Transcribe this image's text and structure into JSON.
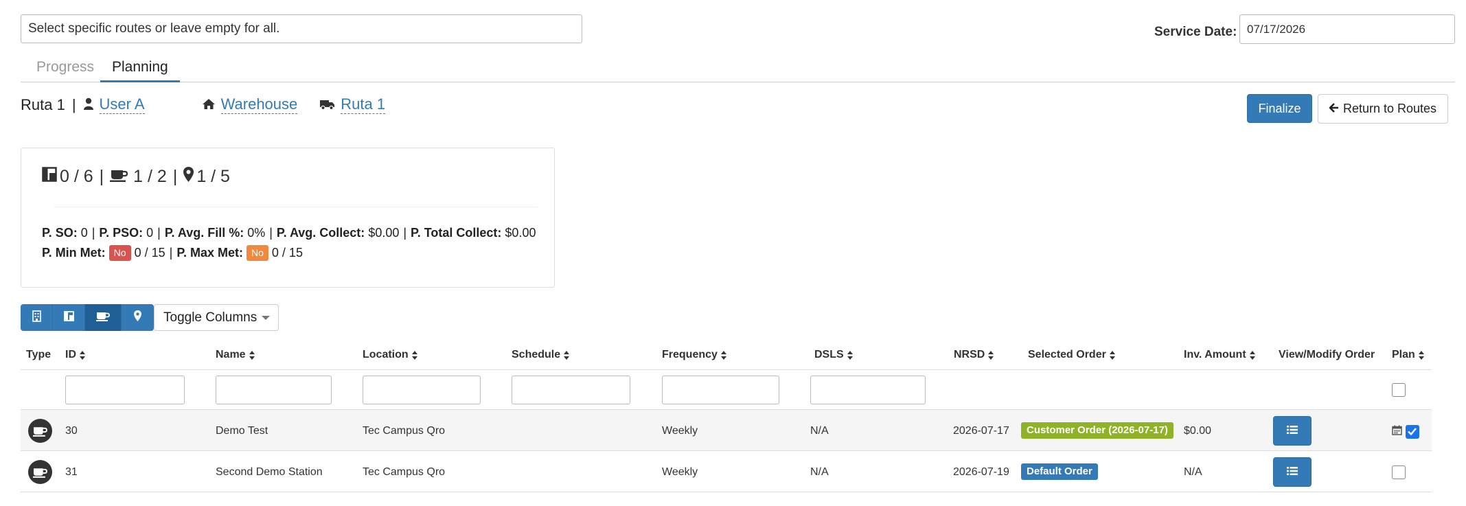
{
  "routes_filter": {
    "placeholder": "Select specific routes or leave empty for all."
  },
  "service_date": {
    "label": "Service Date:",
    "value": "07/17/2026"
  },
  "tabs": [
    {
      "label": "Progress",
      "active": false
    },
    {
      "label": "Planning",
      "active": true
    }
  ],
  "route": {
    "name": "Ruta 1",
    "sep": "|",
    "user_icon": "user-icon",
    "user": "User A",
    "warehouse_icon": "home-icon",
    "warehouse": "Warehouse",
    "vehicle_icon": "truck-icon",
    "vehicle": "Ruta 1"
  },
  "actions": {
    "finalize": "Finalize",
    "return": "Return to Routes",
    "return_icon": "arrow-left-icon"
  },
  "stats": {
    "counts": [
      {
        "icon": "columns-icon",
        "value": "0 / 6"
      },
      {
        "icon": "coffee-icon",
        "value": "1 / 2"
      },
      {
        "icon": "map-marker-icon",
        "value": "1 / 5"
      }
    ],
    "sep": "|",
    "so_label": "P. SO:",
    "so_value": "0",
    "pso_label": "P. PSO:",
    "pso_value": "0",
    "fill_label": "P. Avg. Fill %:",
    "fill_value": "0%",
    "collect_label": "P. Avg. Collect:",
    "collect_value": "$0.00",
    "total_label": "P. Total Collect:",
    "total_value": "$0.00",
    "min_label": "P. Min Met:",
    "min_badge": "No",
    "min_value": "0 / 15",
    "max_label": "P. Max Met:",
    "max_badge": "No",
    "max_value": "0 / 15"
  },
  "colors": {
    "primary": "#337ab7",
    "primary_dark": "#1f5f96",
    "badge_min": "#d9534f",
    "badge_max": "#f0883e",
    "order_customer": "#8fb227",
    "order_default": "#337ab7"
  },
  "view_buttons": [
    {
      "icon": "building-icon",
      "active": false
    },
    {
      "icon": "columns-icon",
      "active": false
    },
    {
      "icon": "coffee-icon",
      "active": true
    },
    {
      "icon": "map-marker-icon",
      "active": false
    }
  ],
  "toggle_columns": "Toggle Columns",
  "table": {
    "headers": {
      "type": "Type",
      "id": "ID",
      "name": "Name",
      "location": "Location",
      "schedule": "Schedule",
      "frequency": "Frequency",
      "dsls": "DSLS",
      "nrsd": "NRSD",
      "selected_order": "Selected Order",
      "inv_amount": "Inv. Amount",
      "view_modify": "View/Modify Order",
      "plan": "Plan"
    },
    "rows": [
      {
        "type_icon": "coffee-icon",
        "id": "30",
        "name": "Demo Test",
        "location": "Tec Campus Qro",
        "schedule": "",
        "frequency": "Weekly",
        "dsls": "N/A",
        "nrsd": "2026-07-17",
        "order": "Customer Order (2026-07-17)",
        "order_kind": "customer",
        "inv_amount": "$0.00",
        "plan_icon": "calendar-icon",
        "planned": true
      },
      {
        "type_icon": "coffee-icon",
        "id": "31",
        "name": "Second Demo Station",
        "location": "Tec Campus Qro",
        "schedule": "",
        "frequency": "Weekly",
        "dsls": "N/A",
        "nrsd": "2026-07-19",
        "order": "Default Order",
        "order_kind": "default",
        "inv_amount": "N/A",
        "plan_icon": "",
        "planned": false
      }
    ]
  }
}
